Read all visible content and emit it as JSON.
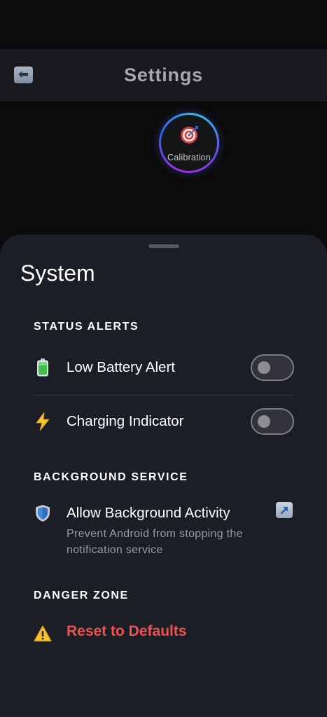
{
  "header": {
    "title": "Settings",
    "back_icon": "left-arrow-icon"
  },
  "calibration": {
    "label": "Calibration",
    "icon": "target-icon"
  },
  "sheet": {
    "title": "System",
    "sections": {
      "status_alerts": {
        "label": "STATUS ALERTS",
        "low_battery": {
          "label": "Low Battery Alert",
          "icon": "battery-icon",
          "enabled": false
        },
        "charging": {
          "label": "Charging Indicator",
          "icon": "lightning-icon",
          "enabled": false
        }
      },
      "background_service": {
        "label": "BACKGROUND SERVICE",
        "allow_background": {
          "label": "Allow Background Activity",
          "description": "Prevent Android from stopping the notification service",
          "icon": "shield-icon",
          "action_icon": "external-link-icon"
        }
      },
      "danger_zone": {
        "label": "DANGER ZONE",
        "reset": {
          "label": "Reset to Defaults",
          "icon": "warning-icon"
        }
      }
    }
  },
  "colors": {
    "background": "#0b0b0c",
    "header": "#18191c",
    "sheet": "#1c1e26",
    "danger": "#f05252",
    "muted_text": "#9a9ba3"
  }
}
